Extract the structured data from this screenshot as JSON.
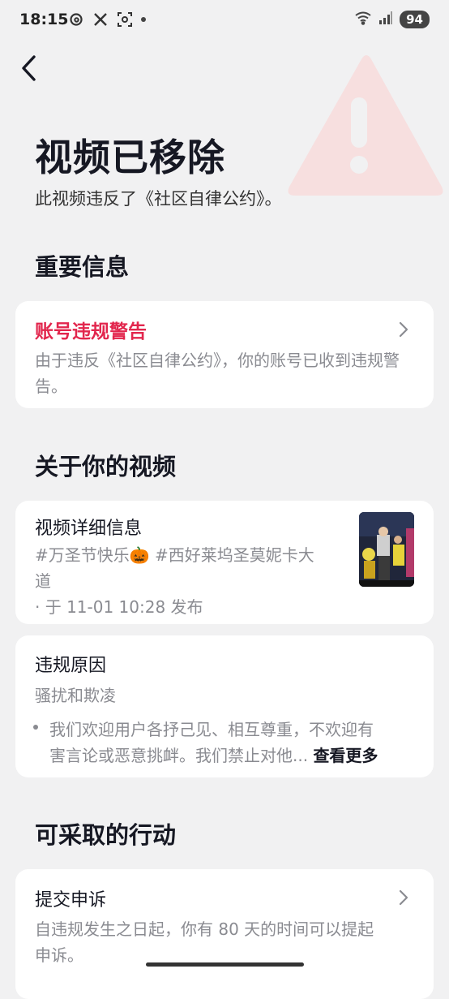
{
  "status_bar": {
    "time": "18:15",
    "left_icons": [
      "threads-icon",
      "x-icon",
      "scan-icon"
    ],
    "battery": "94"
  },
  "header": {
    "title": "视频已移除",
    "subtitle": "此视频违反了《社区自律公约》。"
  },
  "important": {
    "section_title": "重要信息",
    "warning_title": "账号违规警告",
    "warning_desc": "由于违反《社区自律公约》，你的账号已收到违规警告。"
  },
  "about": {
    "section_title": "关于你的视频",
    "details_title": "视频详细信息",
    "tags_line1": "#万圣节快乐🎃 #西好莱坞圣莫妮卡大",
    "tags_line2": "道",
    "posted": "· 于 11-01 10:28 发布",
    "reason_title": "违规原因",
    "reason_category": "骚扰和欺凌",
    "reason_text_line1": "我们欢迎用户各抒己见、相互尊重，不欢迎有",
    "reason_text_line2": "害言论或恶意挑衅。我们禁止对他...",
    "see_more": "查看更多"
  },
  "actions": {
    "section_title": "可采取的行动",
    "appeal_title": "提交申诉",
    "appeal_desc_line1": "自违规发生之日起，你有 80 天的时间可以提起",
    "appeal_desc_line2": "申诉。"
  },
  "colors": {
    "background": "#f1f1f2",
    "accent_red": "#e2264d",
    "card": "#ffffff",
    "muted_text": "#8a8b91"
  }
}
